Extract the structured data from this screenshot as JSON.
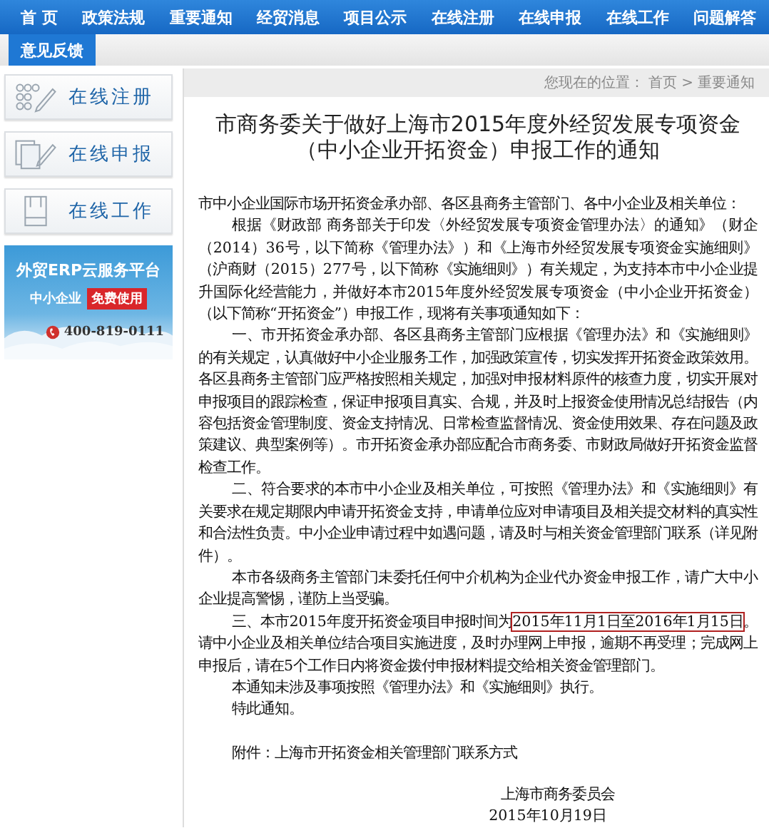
{
  "nav": {
    "rows": [
      [
        {
          "label": "首 页",
          "selected": false
        },
        {
          "label": "政策法规",
          "selected": false
        },
        {
          "label": "重要通知",
          "selected": false
        },
        {
          "label": "经贸消息",
          "selected": false
        },
        {
          "label": "项目公示",
          "selected": false
        },
        {
          "label": "在线注册",
          "selected": false
        },
        {
          "label": "在线申报",
          "selected": false
        },
        {
          "label": "在线工作",
          "selected": false
        },
        {
          "label": "问题解答",
          "selected": false
        }
      ],
      [
        {
          "label": "意见反馈",
          "selected": true
        }
      ]
    ]
  },
  "sidebar": {
    "items": [
      {
        "label": "在线注册"
      },
      {
        "label": "在线申报"
      },
      {
        "label": "在线工作"
      }
    ],
    "banner": {
      "title": "外贸ERP云服务平台",
      "subtitle": "中小企业",
      "badge": "免费使用",
      "phone": "400-819-0111"
    }
  },
  "breadcrumb": {
    "label": "您现在的位置：",
    "items": [
      {
        "text": "首页"
      },
      {
        "text": "重要通知"
      }
    ],
    "separator": ">"
  },
  "article": {
    "title": "市商务委关于做好上海市2015年度外经贸发展专项资金（中小企业开拓资金）申报工作的通知",
    "paragraphs": [
      {
        "kind": "plain",
        "segments": [
          {
            "text": "市中小企业国际市场开拓资金承办部、各区县商务主管部门、各中小企业及相关单位：",
            "highlighted": false
          }
        ]
      },
      {
        "kind": "indented",
        "segments": [
          {
            "text": "根据《财政部 商务部关于印发〈外经贸发展专项资金管理办法〉的通知》（财企（2014）36号，以下简称《管理办法》）和《上海市外经贸发展专项资金实施细则》（沪商财（2015）277号，以下简称《实施细则》）有关规定，为支持本市中小企业提升国际化经营能力，并做好本市2015年度外经贸发展专项资金（中小企业开拓资金）（以下简称“开拓资金”）申报工作，现将有关事项通知如下：",
            "highlighted": false
          }
        ]
      },
      {
        "kind": "indented",
        "segments": [
          {
            "text": "一、市开拓资金承办部、各区县商务主管部门应根据《管理办法》和《实施细则》的有关规定，认真做好中小企业服务工作，加强政策宣传，切实发挥开拓资金政策效用。各区县商务主管部门应严格按照相关规定，加强对申报材料原件的核查力度，切实开展对申报项目的跟踪检查，保证申报项目真实、合规，并及时上报资金使用情况总结报告（内容包括资金管理制度、资金支持情况、日常检查监督情况、资金使用效果、存在问题及政策建议、典型案例等）。市开拓资金承办部应配合市商务委、市财政局做好开拓资金监督检查工作。",
            "highlighted": false
          }
        ]
      },
      {
        "kind": "indented",
        "segments": [
          {
            "text": "二、符合要求的本市中小企业及相关单位，可按照《管理办法》和《实施细则》有关要求在规定期限内申请开拓资金支持，申请单位应对申请项目及相关提交材料的真实性和合法性负责。中小企业申请过程中如遇问题，请及时与相关资金管理部门联系（详见附件）。",
            "highlighted": false
          }
        ]
      },
      {
        "kind": "indented",
        "segments": [
          {
            "text": "本市各级商务主管部门未委托任何中介机构为企业代办资金申报工作，请广大中小企业提高警惕，谨防上当受骗。",
            "highlighted": false
          }
        ]
      },
      {
        "kind": "indented",
        "segments": [
          {
            "text": "三、本市2015年度开拓资金项目申报时间为",
            "highlighted": false
          },
          {
            "text": "2015年11月1日至2016年1月15日",
            "highlighted": true
          },
          {
            "text": "。请中小企业及相关单位结合项目实施进度，及时办理网上申报，逾期不再受理；完成网上申报后，请在5个工作日内将资金拨付申报材料提交给相关资金管理部门。",
            "highlighted": false
          }
        ]
      },
      {
        "kind": "indented",
        "segments": [
          {
            "text": "本通知未涉及事项按照《管理办法》和《实施细则》执行。",
            "highlighted": false
          }
        ]
      },
      {
        "kind": "indented",
        "segments": [
          {
            "text": "特此通知。",
            "highlighted": false
          }
        ]
      }
    ],
    "attachment": "附件：上海市开拓资金相关管理部门联系方式",
    "signature": {
      "issuer": "上海市商务委员会",
      "date": "2015年10月19日"
    }
  }
}
